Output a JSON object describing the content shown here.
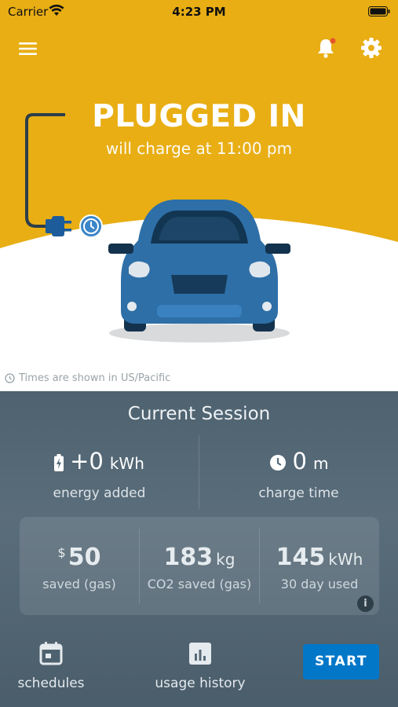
{
  "status_bar": {
    "carrier": "Carrier",
    "time": "4:23 PM"
  },
  "hero": {
    "title": "PLUGGED IN",
    "subtitle": "will charge at 11:00 pm",
    "timezone_note": "Times are shown in US/Pacific",
    "icons": [
      "menu-icon",
      "bell-icon",
      "gear-icon",
      "plug-icon",
      "clock-icon",
      "car-illustration"
    ]
  },
  "session": {
    "title": "Current Session",
    "energy": {
      "value": "+0",
      "unit": "kWh",
      "label": "energy added"
    },
    "charge_time": {
      "value": "0",
      "unit": "m",
      "label": "charge time"
    },
    "savings": [
      {
        "prefix": "$",
        "value": "50",
        "suffix": "",
        "label": "saved (gas)"
      },
      {
        "prefix": "",
        "value": "183",
        "suffix": "kg",
        "label": "CO2 saved (gas)"
      },
      {
        "prefix": "",
        "value": "145",
        "suffix": "kWh",
        "label": "30 day used"
      }
    ],
    "info_label": "i"
  },
  "nav": {
    "schedules_label": "schedules",
    "usage_label": "usage history",
    "start_label": "START"
  },
  "colors": {
    "hero_yellow": "#E8AE14",
    "panel": "#566a78",
    "start_blue": "#0277C8",
    "car_blue": "#2E6FA7"
  }
}
